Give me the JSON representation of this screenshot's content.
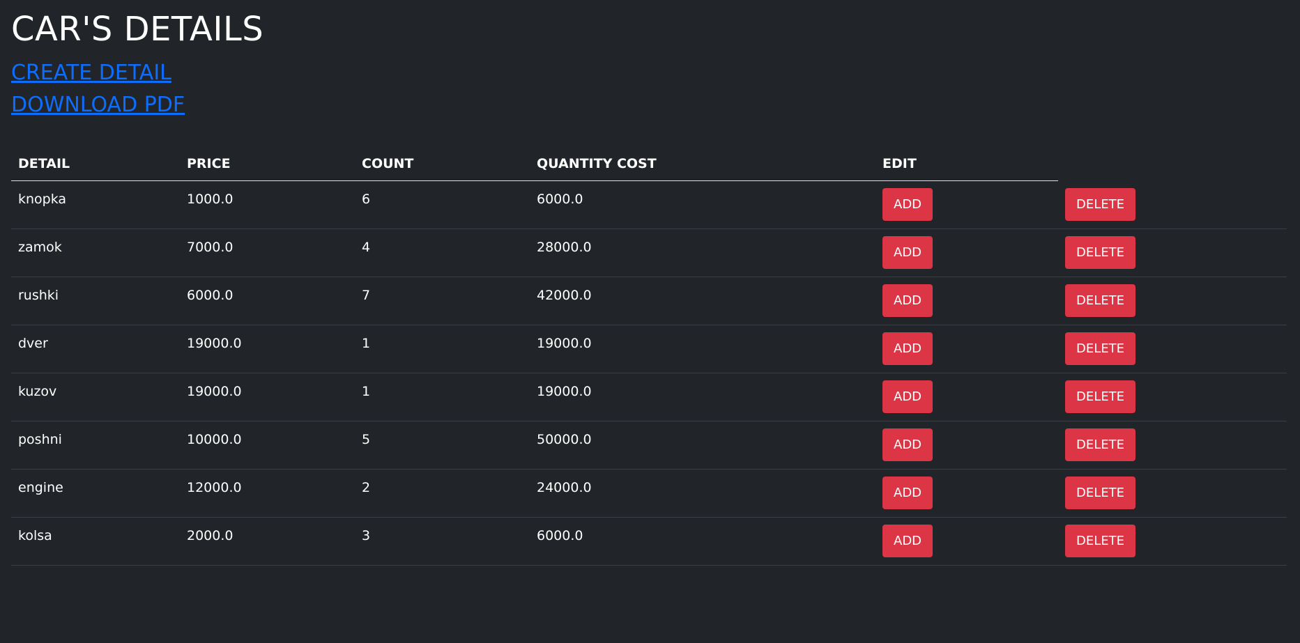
{
  "page": {
    "title": "CAR'S DETAILS",
    "create_link": "CREATE DETAIL",
    "download_link": "DOWNLOAD PDF"
  },
  "table": {
    "headers": [
      "DETAIL",
      "PRICE",
      "COUNT",
      "QUANTITY COST",
      "EDIT"
    ],
    "add_label": "ADD",
    "delete_label": "DELETE",
    "rows": [
      {
        "detail": "knopka",
        "price": "1000.0",
        "count": "6",
        "cost": "6000.0"
      },
      {
        "detail": "zamok",
        "price": "7000.0",
        "count": "4",
        "cost": "28000.0"
      },
      {
        "detail": "rushki",
        "price": "6000.0",
        "count": "7",
        "cost": "42000.0"
      },
      {
        "detail": "dver",
        "price": "19000.0",
        "count": "1",
        "cost": "19000.0"
      },
      {
        "detail": "kuzov",
        "price": "19000.0",
        "count": "1",
        "cost": "19000.0"
      },
      {
        "detail": "poshni",
        "price": "10000.0",
        "count": "5",
        "cost": "50000.0"
      },
      {
        "detail": "engine",
        "price": "12000.0",
        "count": "2",
        "cost": "24000.0"
      },
      {
        "detail": "kolsa",
        "price": "2000.0",
        "count": "3",
        "cost": "6000.0"
      }
    ]
  },
  "colors": {
    "background": "#212529",
    "link": "#0d6efd",
    "danger": "#dc3545"
  }
}
